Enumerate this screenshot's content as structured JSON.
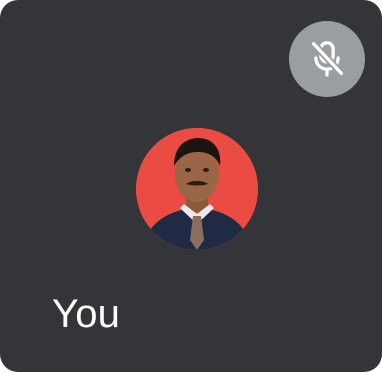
{
  "participant": {
    "name": "You",
    "mic_status_icon": "mic-off-icon",
    "avatar_background": "#ea4b43"
  },
  "colors": {
    "tile_background": "#333538",
    "badge_background": "#9a9ea3",
    "text": "#ffffff"
  }
}
